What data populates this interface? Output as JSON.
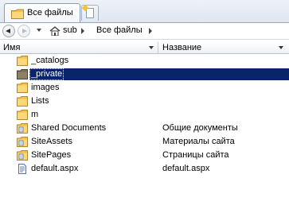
{
  "tab": {
    "label": "Все файлы"
  },
  "breadcrumb": {
    "items": [
      "sub",
      "Все файлы"
    ]
  },
  "columns": {
    "name": "Имя",
    "title": "Название"
  },
  "rows": [
    {
      "name": "_catalogs",
      "title": "",
      "icon": "folder-icon"
    },
    {
      "name": "_private",
      "title": "",
      "icon": "folder-dark-icon",
      "selected": true
    },
    {
      "name": "images",
      "title": "",
      "icon": "folder-icon"
    },
    {
      "name": "Lists",
      "title": "",
      "icon": "folder-icon"
    },
    {
      "name": "m",
      "title": "",
      "icon": "folder-icon"
    },
    {
      "name": "Shared Documents",
      "title": "Общие документы",
      "icon": "doclib-icon"
    },
    {
      "name": "SiteAssets",
      "title": "Материалы сайта",
      "icon": "doclib-icon"
    },
    {
      "name": "SitePages",
      "title": "Страницы сайта",
      "icon": "doclib-icon"
    },
    {
      "name": "default.aspx",
      "title": "default.aspx",
      "icon": "aspx-file-icon"
    }
  ],
  "colors": {
    "selection": "#0a246a",
    "folder": "#f2c14e"
  }
}
